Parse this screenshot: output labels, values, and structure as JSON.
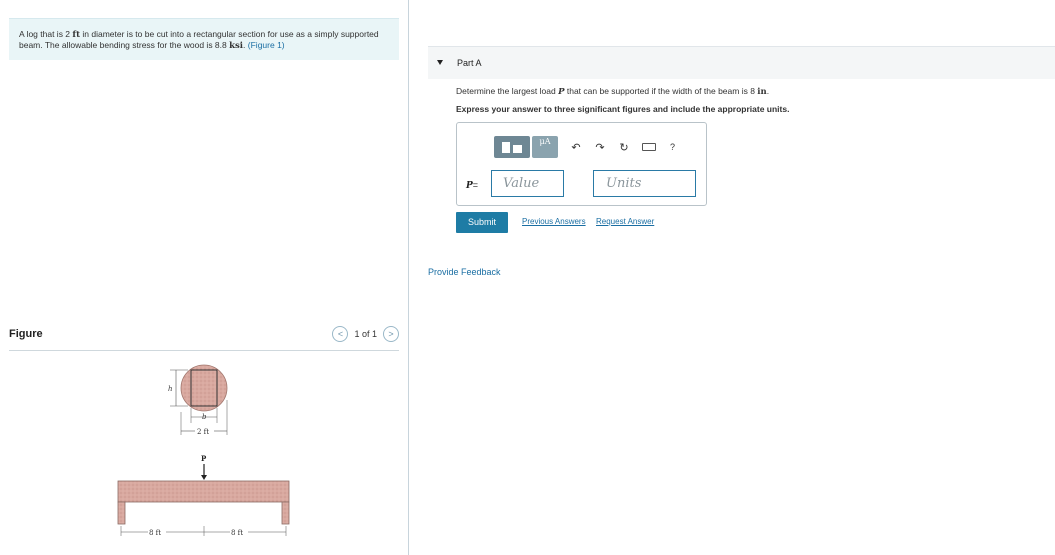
{
  "problem": {
    "text_before": "A log that is 2",
    "unit_ft": "ft",
    "text_mid": "in diameter is to be cut into a rectangular section for use as a simply supported beam. The allowable bending stress for the wood is 8.8",
    "unit_ksi": "ksi",
    "text_after": ".",
    "figure_link": "(Figure 1)"
  },
  "figure": {
    "title": "Figure",
    "pager": "1 of 1",
    "prev_glyph": "<",
    "next_glyph": ">",
    "labels": {
      "h": "h",
      "b": "b",
      "diameter": "2 ft",
      "load": "P",
      "span_left": "8 ft",
      "span_right": "8 ft"
    }
  },
  "part": {
    "label": "Part A",
    "question_before": "Determine the largest load",
    "question_var": "P",
    "question_mid": "that can be supported if the width of the beam is 8",
    "question_unit": "in",
    "question_after": ".",
    "instruction": "Express your answer to three significant figures and include the appropriate units."
  },
  "answer": {
    "var_label": "P",
    "equals": "=",
    "value_placeholder": "Value",
    "units_placeholder": "Units",
    "mu_label": "μA",
    "help": "?"
  },
  "actions": {
    "submit": "Submit",
    "previous_answers": "Previous Answers",
    "request_answer": "Request Answer",
    "provide_feedback": "Provide Feedback"
  },
  "colors": {
    "accent": "#1e7ca5",
    "problem_bg": "#e9f5f7",
    "log": "#d9a9a0",
    "beam": "#d1a39a"
  }
}
